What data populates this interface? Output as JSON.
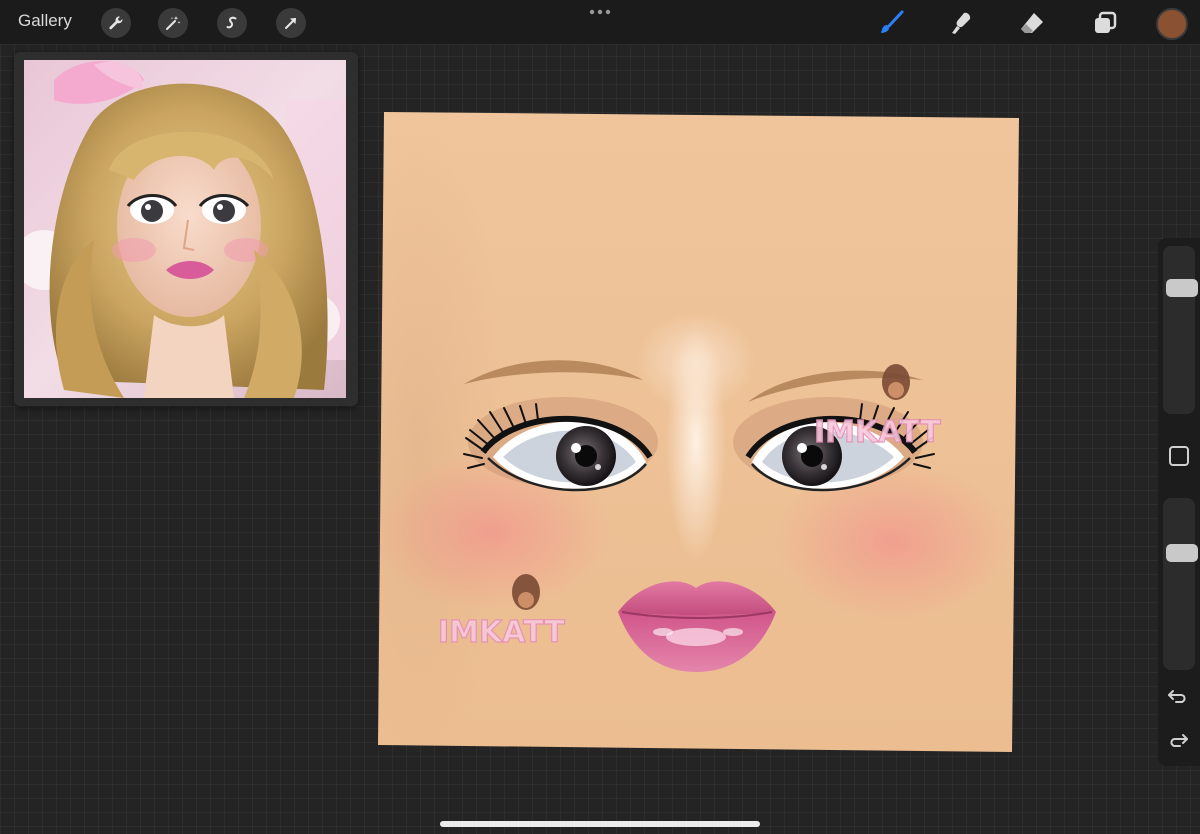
{
  "topbar": {
    "gallery_label": "Gallery",
    "left_tools": [
      {
        "name": "wrench-icon",
        "purpose": "actions"
      },
      {
        "name": "magic-wand-icon",
        "purpose": "adjustments"
      },
      {
        "name": "selection-icon",
        "purpose": "selection"
      },
      {
        "name": "arrow-icon",
        "purpose": "transform"
      }
    ],
    "more_icon": "ellipsis-icon",
    "right_tools": [
      {
        "name": "brush-icon",
        "active": true
      },
      {
        "name": "smudge-icon",
        "active": false
      },
      {
        "name": "eraser-icon",
        "active": false
      },
      {
        "name": "layers-icon",
        "active": false
      }
    ],
    "active_color": "#8a5230"
  },
  "reference": {
    "subject": "blonde-wavy-hair-pink-bow-portrait"
  },
  "canvas": {
    "skin_color": "#eebf94",
    "blush_color": "#f08c8c",
    "lip_color": "#d9608f",
    "watermark_text": "IMKATT"
  },
  "sidebar": {
    "brush_size_level": 0.22,
    "opacity_level": 0.3,
    "undo_icon": "undo-icon",
    "redo_icon": "redo-icon"
  },
  "accent_color": "#2b7ff5"
}
